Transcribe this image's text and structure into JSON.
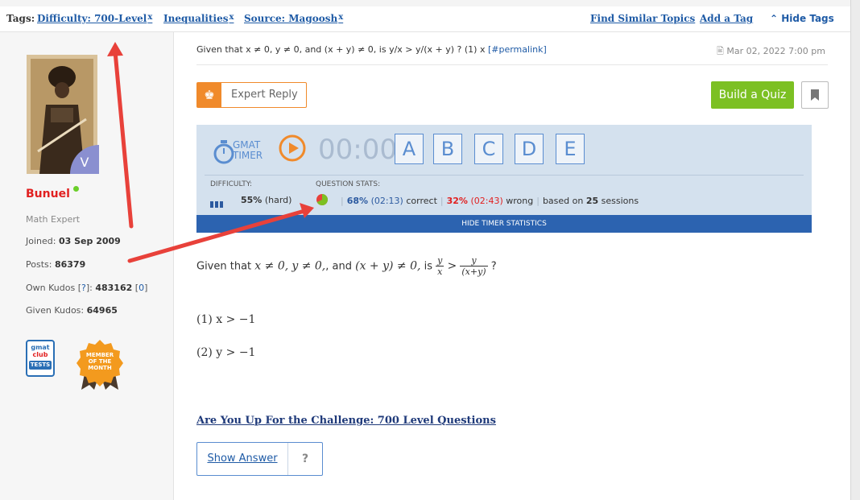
{
  "tags": {
    "label": "Tags:",
    "items": [
      {
        "label": "Difficulty: 700-Level",
        "remove": "x"
      },
      {
        "label": "Inequalities",
        "remove": "x"
      },
      {
        "label": "Source: Magoosh",
        "remove": "x"
      }
    ],
    "find_similar": "Find Similar Topics",
    "add_tag": "Add a Tag",
    "hide_tags": "Hide Tags"
  },
  "user": {
    "name": "Bunuel",
    "rank_badge": "V",
    "role": "Math Expert",
    "joined_label": "Joined:",
    "joined": "03 Sep 2009",
    "posts_label": "Posts:",
    "posts": "86379",
    "own_kudos_label": "Own Kudos [",
    "own_kudos_help": "?",
    "own_kudos_mid": "]:",
    "own_kudos": "483162",
    "own_kudos_extra_open": "[",
    "own_kudos_extra": "0",
    "own_kudos_extra_close": "]",
    "given_kudos_label": "Given Kudos:",
    "given_kudos": "64965",
    "badge_gmat_1": "gmat",
    "badge_gmat_2": "club",
    "badge_gmat_3": "TESTS",
    "motm_1": "MEMBER",
    "motm_2": "OF THE",
    "motm_3": "MONTH"
  },
  "post": {
    "header": "Given that x ≠ 0, y ≠ 0, and (x + y) ≠ 0, is y/x > y/(x + y) ? (1) x",
    "permalink": "[#permalink]",
    "date": "Mar 02, 2022 7:00 pm",
    "expert_reply": "Expert Reply",
    "build_quiz": "Build a Quiz",
    "timer": {
      "logo_1": "GMAT",
      "logo_2": "TIMER",
      "clock": "00:00",
      "options": [
        "A",
        "B",
        "C",
        "D",
        "E"
      ],
      "difficulty_label": "DIFFICULTY:",
      "stats_label": "QUESTION STATS:",
      "difficulty_value": "55%",
      "difficulty_text": "(hard)",
      "correct_pct": "68%",
      "correct_time": "(02:13)",
      "correct_text": "correct",
      "wrong_pct": "32%",
      "wrong_time": "(02:43)",
      "wrong_text": "wrong",
      "based_on": "based on",
      "sessions": "25",
      "sessions_text": "sessions",
      "hide_stats": "HIDE TIMER STATISTICS"
    },
    "question": {
      "intro": "Given that",
      "cond1": "x ≠ 0,",
      "cond2": "y ≠ 0,",
      "and": ", and",
      "cond3": "(x + y) ≠ 0,",
      "is": "is",
      "lhs_num": "y",
      "lhs_den": "x",
      "gt": ">",
      "rhs_num": "y",
      "rhs_den": "(x+y)",
      "end": "?"
    },
    "statement1": "(1) x > −1",
    "statement2": "(2) y > −1",
    "challenge": "Are You Up For the Challenge: 700 Level Questions",
    "show_answer": "Show Answer",
    "help": "?"
  },
  "colors": {
    "link": "#1f5ba6",
    "username": "#e12020",
    "build_quiz": "#7cc023",
    "expert": "#f08a2b",
    "timer_bg": "#d4e1ee",
    "hide_stats_bg": "#2c63b0",
    "annotation_arrow": "#e8413a"
  },
  "correct_fraction": 0.68
}
